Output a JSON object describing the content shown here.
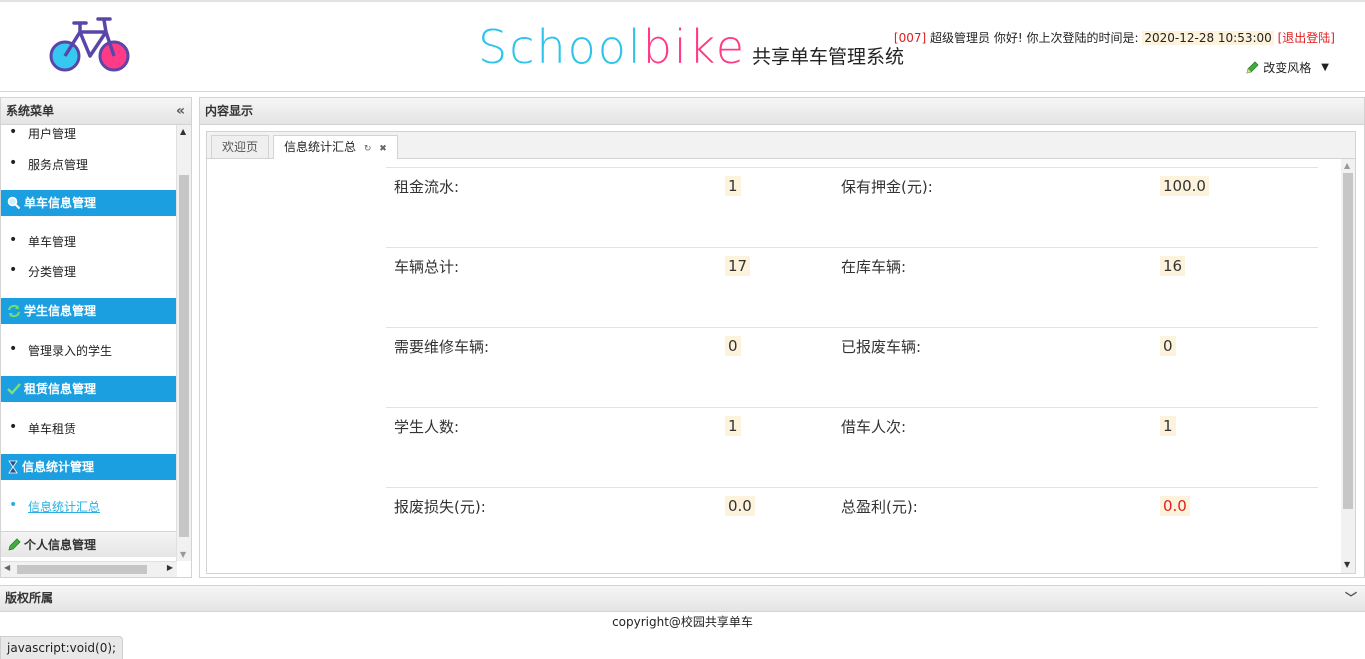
{
  "header": {
    "brand_school": "School",
    "brand_bike": "bike",
    "brand_subtitle": "共享单车管理系统",
    "user_id": "[007]",
    "user_greeting": "超级管理员 你好! 你上次登陆的时间是:",
    "last_login": "2020-12-28 10:53:00",
    "logout_label": "[退出登陆]",
    "style_label": "改变风格"
  },
  "sidebar": {
    "title": "系统菜单",
    "items": [
      {
        "label": "用户管理"
      },
      {
        "label": "服务点管理"
      },
      {
        "group": "单车信息管理",
        "icon": "search-icon"
      },
      {
        "label": "单车管理"
      },
      {
        "label": "分类管理"
      },
      {
        "group": "学生信息管理",
        "icon": "refresh-icon"
      },
      {
        "label": "管理录入的学生"
      },
      {
        "group": "租赁信息管理",
        "icon": "check-icon"
      },
      {
        "label": "单车租赁"
      },
      {
        "group": "信息统计管理",
        "icon": "hourglass-icon"
      },
      {
        "label": "信息统计汇总",
        "active": true
      },
      {
        "group": "个人信息管理",
        "icon": "pencil-icon"
      }
    ]
  },
  "main": {
    "title": "内容显示",
    "tabs": [
      {
        "label": "欢迎页"
      },
      {
        "label": "信息统计汇总",
        "active": true
      }
    ],
    "stats": [
      {
        "label1": "租金流水:",
        "value1": "1",
        "label2": "保有押金(元):",
        "value2": "100.0"
      },
      {
        "label1": "车辆总计:",
        "value1": "17",
        "label2": "在库车辆:",
        "value2": "16"
      },
      {
        "label1": "需要维修车辆:",
        "value1": "0",
        "label2": "已报废车辆:",
        "value2": "0"
      },
      {
        "label1": "学生人数:",
        "value1": "1",
        "label2": "借车人次:",
        "value2": "1"
      },
      {
        "label1": "报废损失(元):",
        "value1": "0.0",
        "label2": "总盈利(元):",
        "value2": "0.0"
      }
    ]
  },
  "footer": {
    "title": "版权所属",
    "copyright": "copyright@校园共享单车",
    "status_text": "javascript:void(0);"
  },
  "colors": {
    "menu_group_bg": "#1c9fe0",
    "brand_blue": "#2ec3ea",
    "brand_pink": "#ff3b88",
    "highlight_bg": "#fdf3dc",
    "alert_red": "#e02020"
  }
}
